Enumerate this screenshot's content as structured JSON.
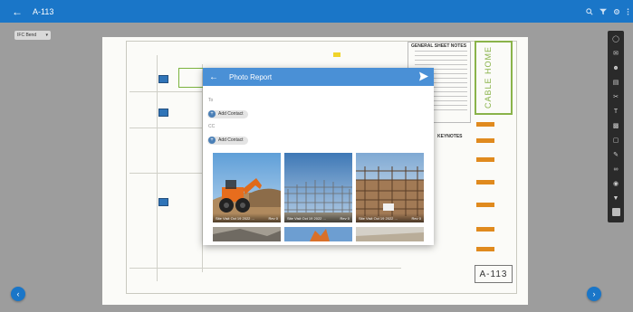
{
  "appbar": {
    "title": "A-113",
    "back_icon": "arrow-left-icon",
    "action_icons": [
      "search-icon",
      "filter-icon",
      "settings-icon",
      "more-vertical-icon"
    ]
  },
  "layer_select": {
    "value": "IFC Bend"
  },
  "sheet": {
    "notes_title": "GENERAL SHEET NOTES",
    "keynotes_title": "KEYNOTES",
    "logo_text": "CABLE HOME",
    "sheet_number": "A-113"
  },
  "toolbar": {
    "icons": [
      "lasso-icon",
      "mail-image-icon",
      "person-tag-icon",
      "comment-icon",
      "cut-icon",
      "text-icon",
      "stamp-icon",
      "shape-icon",
      "note-icon",
      "link-icon",
      "camera-icon",
      "location-pin-icon",
      "layers-icon"
    ]
  },
  "dialog": {
    "title": "Photo Report",
    "to_label": "To",
    "cc_label": "CC",
    "add_contact_label": "Add Contact",
    "photos": [
      {
        "caption": "Site Visit Oct 19 2022 ...",
        "rev": "Rev 0"
      },
      {
        "caption": "Site Visit Oct 19 2022 ...",
        "rev": "Rev 0"
      },
      {
        "caption": "Site Visit Oct 19 2022 ...",
        "rev": "Rev 0"
      }
    ]
  },
  "colors": {
    "primary": "#1a76c8",
    "dialog_header": "#4a90d6",
    "accent_green": "#8ab34a",
    "accent_orange": "#e08a1e"
  }
}
